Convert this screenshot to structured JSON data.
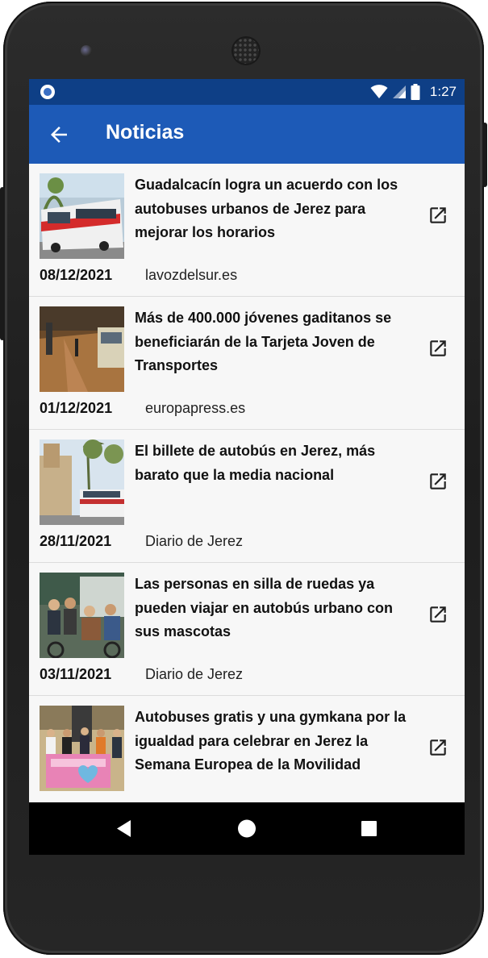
{
  "status_bar": {
    "time": "1:27"
  },
  "app_bar": {
    "title": "Noticias",
    "back_icon": "arrow-back-icon"
  },
  "news": [
    {
      "title": "Guadalcacín logra un acuerdo con los autobuses urbanos de Jerez para mejorar los horarios",
      "date": "08/12/2021",
      "source": "lavozdelsur.es"
    },
    {
      "title": "Más de 400.000 jóvenes gaditanos se beneficiarán de la Tarjeta Joven de Transportes",
      "date": "01/12/2021",
      "source": "europapress.es"
    },
    {
      "title": "El billete de autobús en Jerez, más barato que la media nacional",
      "date": "28/11/2021",
      "source": "Diario de Jerez"
    },
    {
      "title": "Las personas en silla de ruedas ya pueden viajar en autobús urbano con sus mascotas",
      "date": "03/11/2021",
      "source": "Diario de Jerez"
    },
    {
      "title": "Autobuses gratis y una gymkana por la igualdad para celebrar en Jerez la Semana Europea de la Movilidad",
      "date": "",
      "source": ""
    }
  ],
  "colors": {
    "status_bar": "#0e3f86",
    "app_bar": "#1d5ab7",
    "list_bg": "#f7f7f7",
    "nav_bar": "#000000"
  },
  "icons": {
    "external_link": "open-in-new-icon",
    "nav_back": "triangle-back-icon",
    "nav_home": "circle-home-icon",
    "nav_recents": "square-recents-icon"
  }
}
